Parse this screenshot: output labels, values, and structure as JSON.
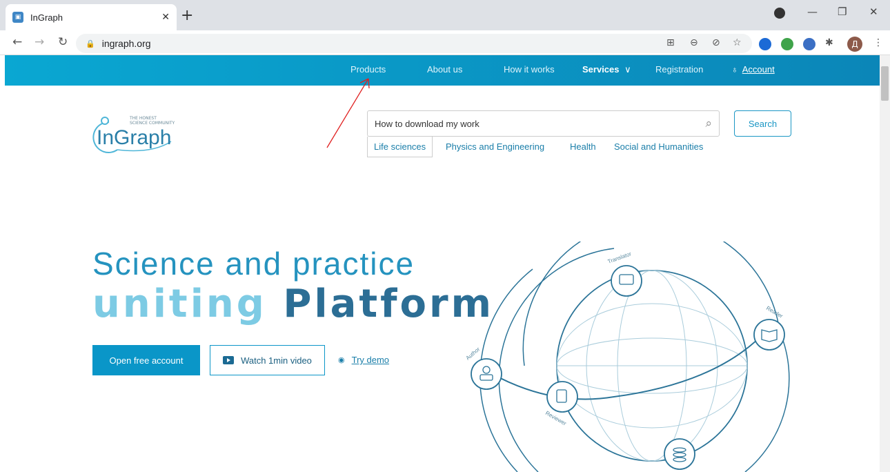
{
  "browser": {
    "tab_title": "InGraph",
    "url": "ingraph.org",
    "avatar_letter": "Д"
  },
  "nav": {
    "items": [
      "Products",
      "About us",
      "How it works",
      "Services",
      "Registration",
      "Account"
    ],
    "services_chevron": "∨"
  },
  "logo": {
    "tagline_1": "THE HONEST",
    "tagline_2": "SCIENCE COMMUNITY",
    "name": "InGraph"
  },
  "search": {
    "value": "How to download my work",
    "button": "Search",
    "categories": [
      "Life sciences",
      "Physics and Engineering",
      "Health",
      "Social and Humanities"
    ]
  },
  "hero": {
    "line1": "Science and practice",
    "line2a": "uniting",
    "line2b": "Platform"
  },
  "cta": {
    "open_account": "Open free account",
    "watch_video": "Watch 1min video",
    "try_demo": "Try demo"
  },
  "globe_roles": [
    "Translator",
    "Reader",
    "Author",
    "Reviewer"
  ],
  "colors": {
    "nav_start": "#0aa7d2",
    "nav_end": "#0b86b8",
    "primary": "#0a96c8",
    "hero_light": "#7dcbe4",
    "hero_dark": "#2c6e95"
  }
}
